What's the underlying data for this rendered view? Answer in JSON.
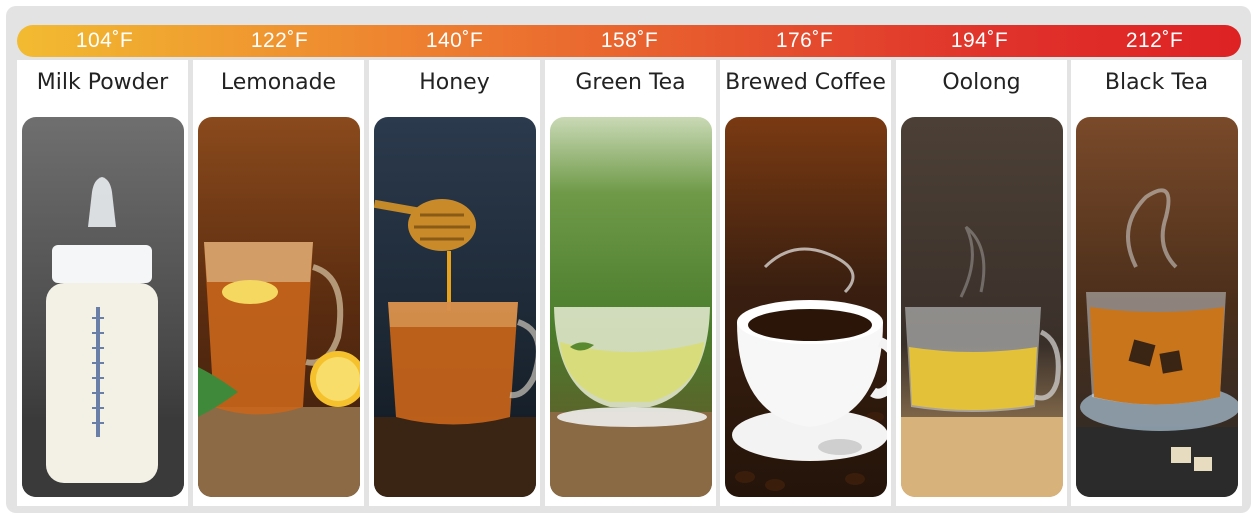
{
  "temperatures": [
    "104˚F",
    "122˚F",
    "140˚F",
    "158˚F",
    "176˚F",
    "194˚F",
    "212˚F"
  ],
  "drinks": [
    {
      "label": "Milk Powder",
      "icon": "baby-bottle-photo"
    },
    {
      "label": "Lemonade",
      "icon": "lemon-tea-photo"
    },
    {
      "label": "Honey",
      "icon": "honey-tea-photo"
    },
    {
      "label": "Green Tea",
      "icon": "green-tea-photo"
    },
    {
      "label": "Brewed Coffee",
      "icon": "coffee-cup-photo"
    },
    {
      "label": "Oolong",
      "icon": "oolong-tea-photo"
    },
    {
      "label": "Black Tea",
      "icon": "black-tea-photo"
    }
  ],
  "colors": {
    "bar_start": "#f2bb31",
    "bar_end": "#de2224",
    "frame": "#e3e3e3"
  }
}
